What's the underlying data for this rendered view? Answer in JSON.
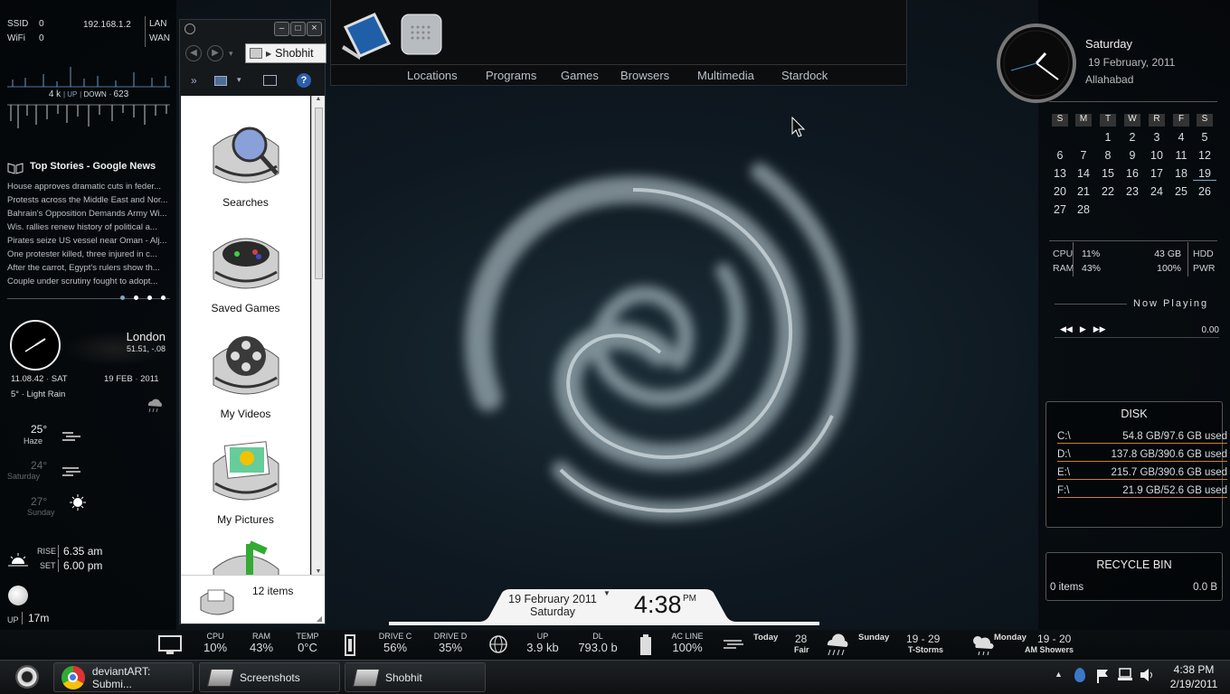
{
  "network": {
    "ssid_label": "SSID",
    "ssid_val": "0",
    "wifi_label": "WiFi",
    "wifi_val": "0",
    "ip": "192.168.1.2",
    "lan": "LAN",
    "wan": "WAN",
    "up_val": "4 k",
    "up_label": "UP",
    "down_label": "DOWN",
    "down_val": "623"
  },
  "news": {
    "title": "Top Stories - Google News",
    "items": [
      "House approves dramatic cuts in feder...",
      "Protests across the Middle East and Nor...",
      "Bahrain's Opposition Demands Army Wi...",
      "Wis. rallies renew history of political a...",
      "Pirates seize US vessel near Oman - Alj...",
      "One protester killed, three injured in c...",
      "After the carrot, Egypt's rulers show th...",
      "Couple under scrutiny fought to adopt..."
    ]
  },
  "clock_left": {
    "city": "London",
    "coords": "51.51, -.08",
    "time": "11.08.42",
    "day": "SAT",
    "date": "19 FEB",
    "year": "2011",
    "weather": "5° · Light Rain"
  },
  "forecast": [
    {
      "temp": "25°",
      "label": "Haze"
    },
    {
      "temp": "24°",
      "label": "Saturday"
    },
    {
      "temp": "27°",
      "label": "Sunday"
    }
  ],
  "sun": {
    "rise_label": "RISE",
    "rise": "6.35 am",
    "set_label": "SET",
    "set": "6.00 pm",
    "up_label": "UP",
    "up": "17m"
  },
  "explorer": {
    "title": "Shobhit",
    "folders": [
      "Searches",
      "Saved Games",
      "My Videos",
      "My Pictures"
    ],
    "status": "12 items"
  },
  "dock": {
    "tabs": [
      "Locations",
      "Programs",
      "Games",
      "Browsers",
      "Multimedia",
      "Stardock"
    ]
  },
  "clock_right": {
    "day": "Saturday",
    "date": "19 February, 2011",
    "city": "Allahabad"
  },
  "calendar": {
    "headers": [
      "S",
      "M",
      "T",
      "W",
      "R",
      "F",
      "S"
    ],
    "weeks": [
      [
        "",
        "",
        "1",
        "2",
        "3",
        "4",
        "5"
      ],
      [
        "6",
        "7",
        "8",
        "9",
        "10",
        "11",
        "12"
      ],
      [
        "13",
        "14",
        "15",
        "16",
        "17",
        "18",
        "19"
      ],
      [
        "20",
        "21",
        "22",
        "23",
        "24",
        "25",
        "26"
      ],
      [
        "27",
        "28",
        "",
        "",
        "",
        "",
        ""
      ]
    ]
  },
  "system": {
    "cpu_label": "CPU",
    "cpu": "11%",
    "ram_label": "RAM",
    "ram": "43%",
    "hdd_val": "43 GB",
    "hdd_label": "HDD",
    "pwr_val": "100%",
    "pwr_label": "PWR"
  },
  "now_playing": {
    "label": "Now Playing",
    "time": "0.00"
  },
  "disk": {
    "title": "DISK",
    "drives": [
      {
        "name": "C:\\",
        "usage": "54.8 GB/97.6 GB used"
      },
      {
        "name": "D:\\",
        "usage": "137.8 GB/390.6 GB used"
      },
      {
        "name": "E:\\",
        "usage": "215.7 GB/390.6 GB used"
      },
      {
        "name": "F:\\",
        "usage": "21.9 GB/52.6 GB used"
      }
    ]
  },
  "recycle": {
    "title": "RECYCLE BIN",
    "items": "0 items",
    "size": "0.0 B"
  },
  "center_clock": {
    "date": "19 February 2011",
    "day": "Saturday",
    "time": "4:38",
    "ampm": "PM"
  },
  "stats": {
    "cpu_k": "CPU",
    "cpu_v": "10%",
    "ram_k": "RAM",
    "ram_v": "43%",
    "temp_k": "TEMP",
    "temp_v": "0°C",
    "drivec_k": "DRIVE C",
    "drivec_v": "56%",
    "drived_k": "DRIVE D",
    "drived_v": "35%",
    "up_k": "UP",
    "up_v": "3.9 kb",
    "dl_k": "DL",
    "dl_v": "793.0 b",
    "ac_k": "AC LINE",
    "ac_v": "100%",
    "today_k": "Today",
    "today_t": "28",
    "today_c": "Fair",
    "sun_k": "Sunday",
    "sun_t": "19 - 29",
    "sun_c": "T-Storms",
    "mon_k": "Monday",
    "mon_t": "19 - 20",
    "mon_c": "AM Showers"
  },
  "taskbar": {
    "buttons": [
      "deviantART: Submi...",
      "Screenshots",
      "Shobhit"
    ],
    "time": "4:38 PM",
    "date": "2/19/2011"
  }
}
